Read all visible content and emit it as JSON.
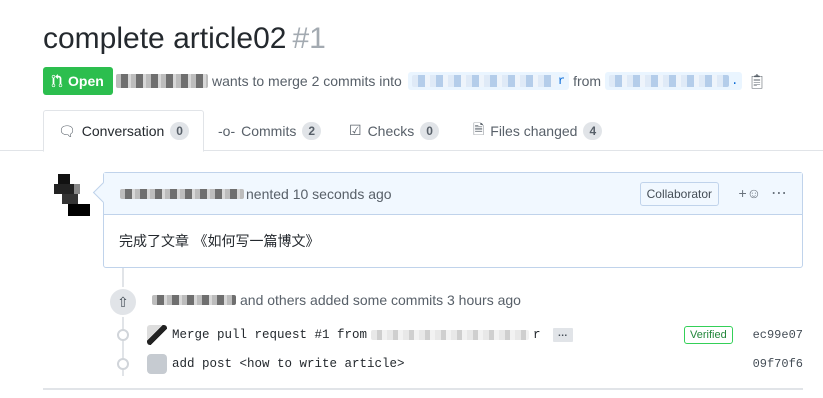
{
  "pr": {
    "title": "complete article02",
    "number": "#1",
    "state": "Open",
    "merge_text_prefix": "wants to merge 2 commits into",
    "base_ref_tail": "r",
    "from_word": "from",
    "head_ref_tail": "."
  },
  "tabs": [
    {
      "label": "Conversation",
      "count": "0",
      "icon": "comment-discussion-icon"
    },
    {
      "label": "Commits",
      "count": "2",
      "icon": "git-commit-icon"
    },
    {
      "label": "Checks",
      "count": "0",
      "icon": "checklist-icon"
    },
    {
      "label": "Files changed",
      "count": "4",
      "icon": "file-diff-icon"
    }
  ],
  "comment": {
    "header_suffix": "nented 10 seconds ago",
    "role_badge": "Collaborator",
    "body": "完成了文章 《如何写一篇博文》"
  },
  "event": {
    "text": "and others added some commits 3 hours ago"
  },
  "commits": [
    {
      "message": "Merge pull request #1 from",
      "ref_tail": "r",
      "verified": "Verified",
      "sha": "ec99e07"
    },
    {
      "message": "add post <how to write article>",
      "sha": "09f70f6"
    }
  ],
  "colors": {
    "open_green": "#2cbe4e",
    "link_blue": "#0366d6",
    "comment_border": "#c0d3eb",
    "comment_header_bg": "#f1f8ff"
  }
}
